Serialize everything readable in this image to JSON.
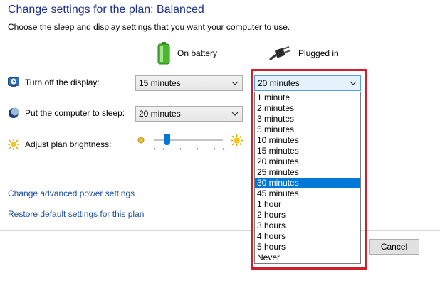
{
  "header": {
    "title": "Change settings for the plan: Balanced",
    "subtitle": "Choose the sleep and display settings that you want your computer to use."
  },
  "columns": {
    "on_battery": "On battery",
    "plugged_in": "Plugged in"
  },
  "rows": {
    "display": {
      "label": "Turn off the display:",
      "battery_value": "15 minutes",
      "plugged_value": "20 minutes",
      "icon": "monitor-icon"
    },
    "sleep": {
      "label": "Put the computer to sleep:",
      "battery_value": "20 minutes",
      "icon": "moon-icon"
    },
    "brightness": {
      "label": "Adjust plan brightness:",
      "icon": "sun-icon",
      "battery_level": 0.18
    }
  },
  "dropdown": {
    "options": [
      "1 minute",
      "2 minutes",
      "3 minutes",
      "5 minutes",
      "10 minutes",
      "15 minutes",
      "20 minutes",
      "25 minutes",
      "30 minutes",
      "45 minutes",
      "1 hour",
      "2 hours",
      "3 hours",
      "4 hours",
      "5 hours",
      "Never"
    ],
    "highlighted": "30 minutes"
  },
  "links": {
    "advanced": "Change advanced power settings",
    "restore": "Restore default settings for this plan"
  },
  "buttons": {
    "cancel": "Cancel"
  },
  "colors": {
    "title": "#1e3287",
    "link": "#1e50a2",
    "highlight": "#d0202e",
    "selection": "#0078d7"
  }
}
